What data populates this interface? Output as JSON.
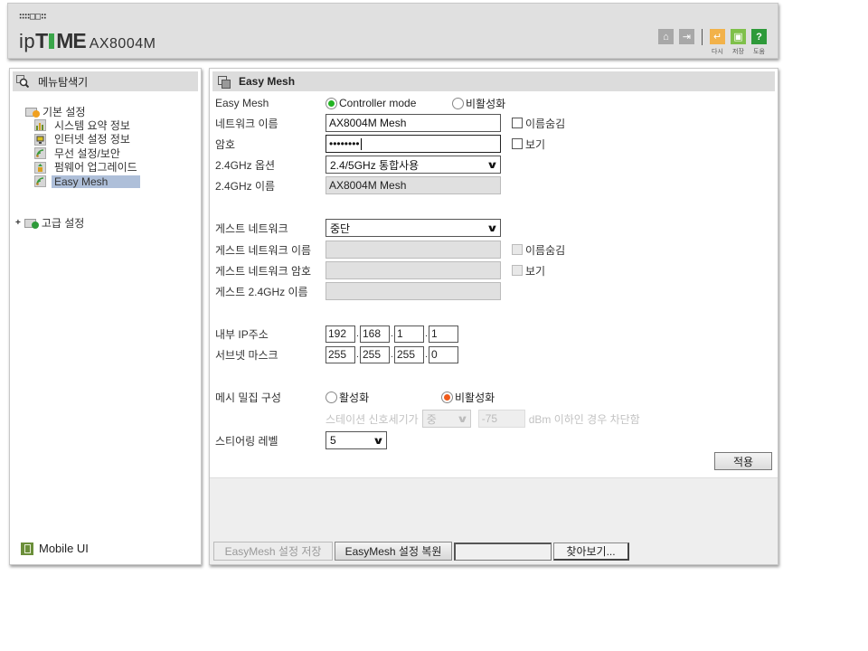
{
  "header": {
    "logo_dots": "∷∷□□∷",
    "brand_prefix": "ip",
    "brand_t": "T",
    "brand_rest": "ME",
    "model": "AX8004M",
    "icons": [
      {
        "name": "home-icon",
        "glyph": "⌂",
        "label": ""
      },
      {
        "name": "logout-icon",
        "glyph": "⇥",
        "label": ""
      },
      {
        "name": "restart-icon",
        "glyph": "↵",
        "label": "다시"
      },
      {
        "name": "save-icon",
        "glyph": "▣",
        "label": "저장"
      },
      {
        "name": "help-icon",
        "glyph": "?",
        "label": "도움"
      }
    ]
  },
  "sidebar": {
    "title": "메뉴탐색기",
    "basic_settings": "기본 설정",
    "items": [
      {
        "label": "시스템 요약 정보",
        "active": false
      },
      {
        "label": "인터넷 설정 정보",
        "active": false
      },
      {
        "label": "무선 설정/보안",
        "active": false
      },
      {
        "label": "펌웨어 업그레이드",
        "active": false
      },
      {
        "label": "Easy Mesh",
        "active": true
      }
    ],
    "advanced_settings": "고급 설정",
    "advanced_expander": "+",
    "mobile_ui": "Mobile UI"
  },
  "main": {
    "title": "Easy Mesh",
    "easymesh": {
      "label": "Easy Mesh",
      "option_controller": "Controller mode",
      "option_disable": "비활성화",
      "selected": "Controller mode"
    },
    "network_name": {
      "label": "네트워크 이름",
      "value": "AX8004M Mesh",
      "hide_label": "이름숨김",
      "hide_checked": false
    },
    "password": {
      "label": "암호",
      "value": "••••••••",
      "show_label": "보기",
      "show_checked": false
    },
    "band_option": {
      "label": "2.4GHz 옵션",
      "value": "2.4/5GHz 통합사용"
    },
    "band_name": {
      "label": "2.4GHz 이름",
      "value": "AX8004M Mesh"
    },
    "guest_network": {
      "label": "게스트 네트워크",
      "value": "중단"
    },
    "guest_name": {
      "label": "게스트 네트워크 이름",
      "value": "",
      "hide_label": "이름숨김"
    },
    "guest_password": {
      "label": "게스트 네트워크 암호",
      "value": "",
      "show_label": "보기"
    },
    "guest_24_name": {
      "label": "게스트 2.4GHz 이름",
      "value": ""
    },
    "internal_ip": {
      "label": "내부 IP주소",
      "octets": [
        "192",
        "168",
        "1",
        "1"
      ]
    },
    "subnet_mask": {
      "label": "서브넷 마스크",
      "octets": [
        "255",
        "255",
        "255",
        "0"
      ]
    },
    "dense_config": {
      "label": "메시 밀집 구성",
      "option_enable": "활성화",
      "option_disable": "비활성화",
      "selected": "비활성화",
      "signal_prefix": "스테이션 신호세기가",
      "signal_level": "중",
      "signal_value": "-75",
      "signal_suffix": "dBm 이하인 경우 차단함"
    },
    "steering_level": {
      "label": "스티어링 레벨",
      "value": "5"
    },
    "apply_label": "적용",
    "save_config_label": "EasyMesh 설정 저장",
    "restore_config_label": "EasyMesh 설정 복원",
    "file_value": "",
    "browse_label": "찾아보기..."
  },
  "colors": {
    "selected_highlight": "#aebfd9",
    "radio_green": "#22b422",
    "radio_orange": "#f05a1a",
    "brand_green": "#3aa64a"
  }
}
